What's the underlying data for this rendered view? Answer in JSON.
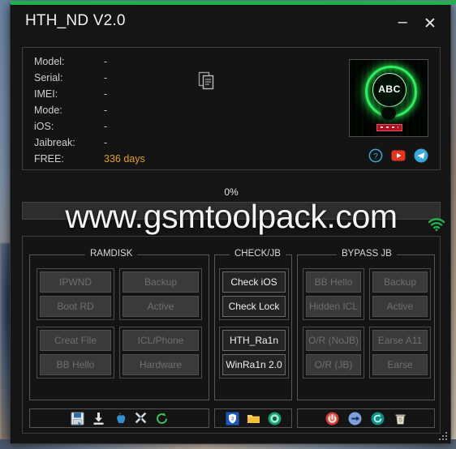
{
  "window": {
    "title": "HTH_ND V2.0",
    "minimize_label": "–",
    "close_label": "✕",
    "accent_color": "#21b14c"
  },
  "device_info": {
    "rows": [
      {
        "label": "Model:",
        "value": "-"
      },
      {
        "label": "Serial:",
        "value": "-"
      },
      {
        "label": "IMEI:",
        "value": "-"
      },
      {
        "label": "Mode:",
        "value": "-"
      },
      {
        "label": "iOS:",
        "value": "-"
      },
      {
        "label": "Jaibreak:",
        "value": "-"
      },
      {
        "label": "FREE:",
        "value": "336 days",
        "highlight": true
      }
    ],
    "highlight_color": "#e0a024",
    "copy_icon": "copy-icon",
    "logo_text": "ABC",
    "social": [
      {
        "name": "help-icon",
        "label": "?"
      },
      {
        "name": "youtube-icon",
        "label": "▶"
      },
      {
        "name": "telegram-icon",
        "label": "➤"
      }
    ]
  },
  "progress": {
    "percent_label": "0%",
    "percent_value": 0
  },
  "watermark": {
    "text": "www.gsmtoolpack.com",
    "wifi_icon": "wifi-icon"
  },
  "groups": [
    {
      "id": "ramdisk",
      "title": "RAMDISK",
      "buttons": [
        {
          "label": "IPWND",
          "enabled": false
        },
        {
          "label": "Backup",
          "enabled": false
        },
        {
          "label": "Boot RD",
          "enabled": false
        },
        {
          "label": "Active",
          "enabled": false
        },
        {
          "label": "Creat File",
          "enabled": false
        },
        {
          "label": "ICL/Phone",
          "enabled": false
        },
        {
          "label": "BB Hello",
          "enabled": false
        },
        {
          "label": "Hardware",
          "enabled": false
        }
      ]
    },
    {
      "id": "checkjb",
      "title": "CHECK/JB",
      "buttons": [
        {
          "label": "Check iOS",
          "enabled": true
        },
        {
          "label": "Check Lock",
          "enabled": true
        },
        {
          "label": "HTH_Ra1n",
          "enabled": true
        },
        {
          "label": "WinRa1n 2.0",
          "enabled": true
        }
      ]
    },
    {
      "id": "bypassjb",
      "title": "BYPASS JB",
      "buttons": [
        {
          "label": "BB Hello",
          "enabled": false
        },
        {
          "label": "Backup",
          "enabled": false
        },
        {
          "label": "Hidden ICL",
          "enabled": false
        },
        {
          "label": "Active",
          "enabled": false
        },
        {
          "label": "O/R (NoJB)",
          "enabled": false
        },
        {
          "label": "Earse A11",
          "enabled": false
        },
        {
          "label": "O/R (JB)",
          "enabled": false
        },
        {
          "label": "Earse",
          "enabled": false
        }
      ]
    }
  ],
  "toolbars": {
    "left": [
      "save-icon",
      "download-icon",
      "apple-icon",
      "tools-icon",
      "refresh-icon"
    ],
    "mid": [
      "shield-icon",
      "folder-icon",
      "gear-icon"
    ],
    "right": [
      "power-icon",
      "exit-icon",
      "reboot-icon",
      "trash-icon"
    ]
  }
}
